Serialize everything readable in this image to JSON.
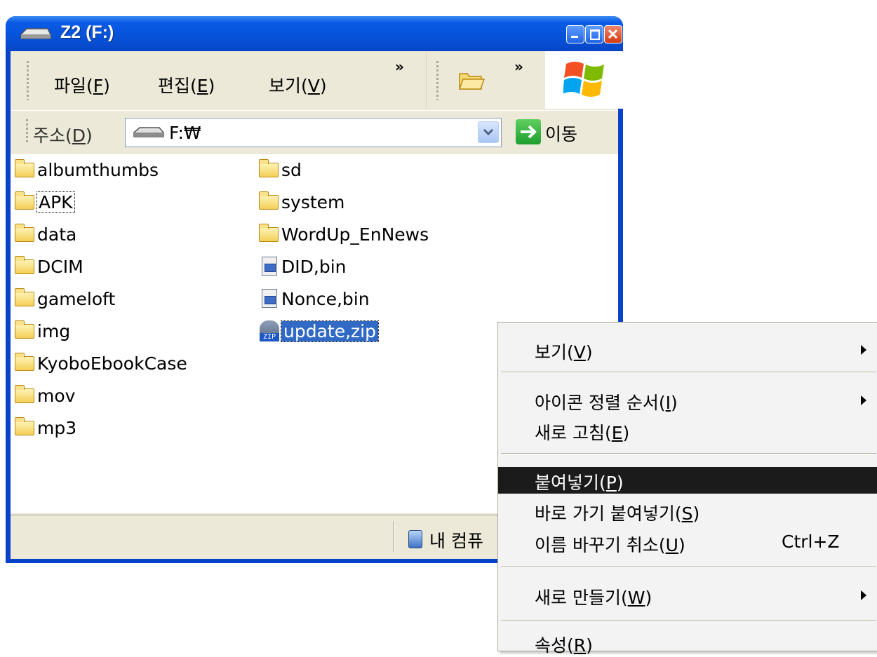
{
  "window": {
    "title": "Z2 (F:)",
    "menu": [
      "파일(F)",
      "편집(E)",
      "보기(V)"
    ],
    "menu_mnemonics": [
      "F",
      "E",
      "V"
    ],
    "chevron": "»"
  },
  "address_bar": {
    "label": "주소(D)",
    "value": "F:₩",
    "go_label": "이동"
  },
  "files": [
    {
      "name": "albumthumbs",
      "type": "folder"
    },
    {
      "name": "APK",
      "type": "folder",
      "focused": true
    },
    {
      "name": "data",
      "type": "folder"
    },
    {
      "name": "DCIM",
      "type": "folder"
    },
    {
      "name": "gameloft",
      "type": "folder"
    },
    {
      "name": "img",
      "type": "folder"
    },
    {
      "name": "KyoboEbookCase",
      "type": "folder"
    },
    {
      "name": "mov",
      "type": "folder"
    },
    {
      "name": "mp3",
      "type": "folder"
    },
    {
      "name": "sd",
      "type": "folder"
    },
    {
      "name": "system",
      "type": "folder"
    },
    {
      "name": "WordUp_EnNews",
      "type": "folder"
    },
    {
      "name": "DID,bin",
      "type": "bin-file"
    },
    {
      "name": "Nonce,bin",
      "type": "bin-file"
    },
    {
      "name": "update,zip",
      "type": "zip-file",
      "selected": true
    }
  ],
  "status_bar": {
    "text": "내 컴퓨"
  },
  "context_menu": {
    "items": [
      {
        "label": "보기(V)",
        "submenu": true
      },
      {
        "label": "아이콘 정렬 순서(I)",
        "submenu": true
      },
      {
        "label": "새로 고침(E)"
      },
      {
        "label": "붙여넣기(P)",
        "highlighted": true
      },
      {
        "label": "바로 가기 붙여넣기(S)"
      },
      {
        "label": "이름 바꾸기 취소(U)",
        "shortcut": "Ctrl+Z"
      },
      {
        "label": "새로 만들기(W)",
        "submenu": true
      },
      {
        "label": "속성(R)"
      }
    ]
  },
  "colors": {
    "titlebar": "#0652d8",
    "selection": "#316ac5",
    "menu_highlight": "#1b1b1b",
    "window_face": "#ece9d8"
  }
}
